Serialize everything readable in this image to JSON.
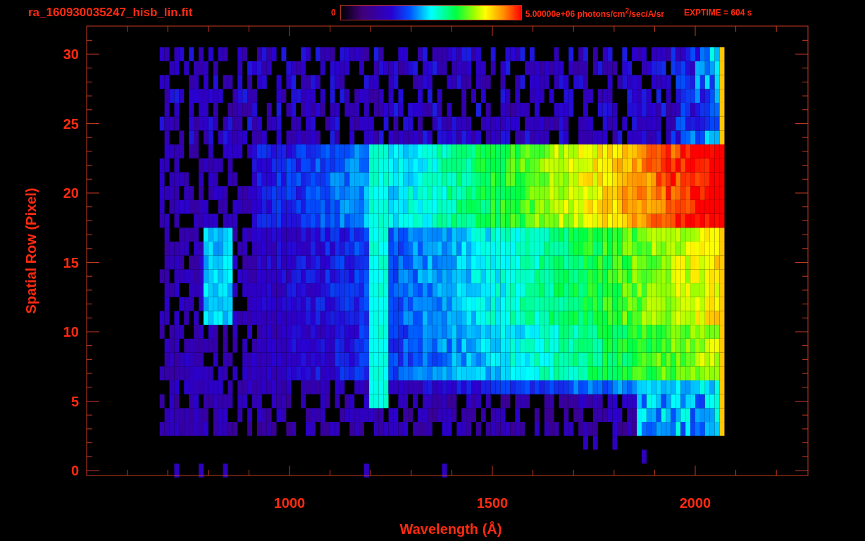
{
  "header": {
    "title": "ra_160930035247_hisb_lin.fit",
    "colorbar": {
      "min_label": "0",
      "max_label": "5.00000e+06 photons/cm$^{2}$/sec/A/sr"
    },
    "exposure": "EXPTIME = 604 s"
  },
  "plot": {
    "xlabel": "Wavelength (Å)",
    "ylabel": "Spatial Row (Pixel)",
    "xticks": [
      "1000",
      "1500",
      "2000"
    ],
    "yticks": [
      "30",
      "25",
      "20",
      "15",
      "10",
      "5",
      "0"
    ]
  }
}
